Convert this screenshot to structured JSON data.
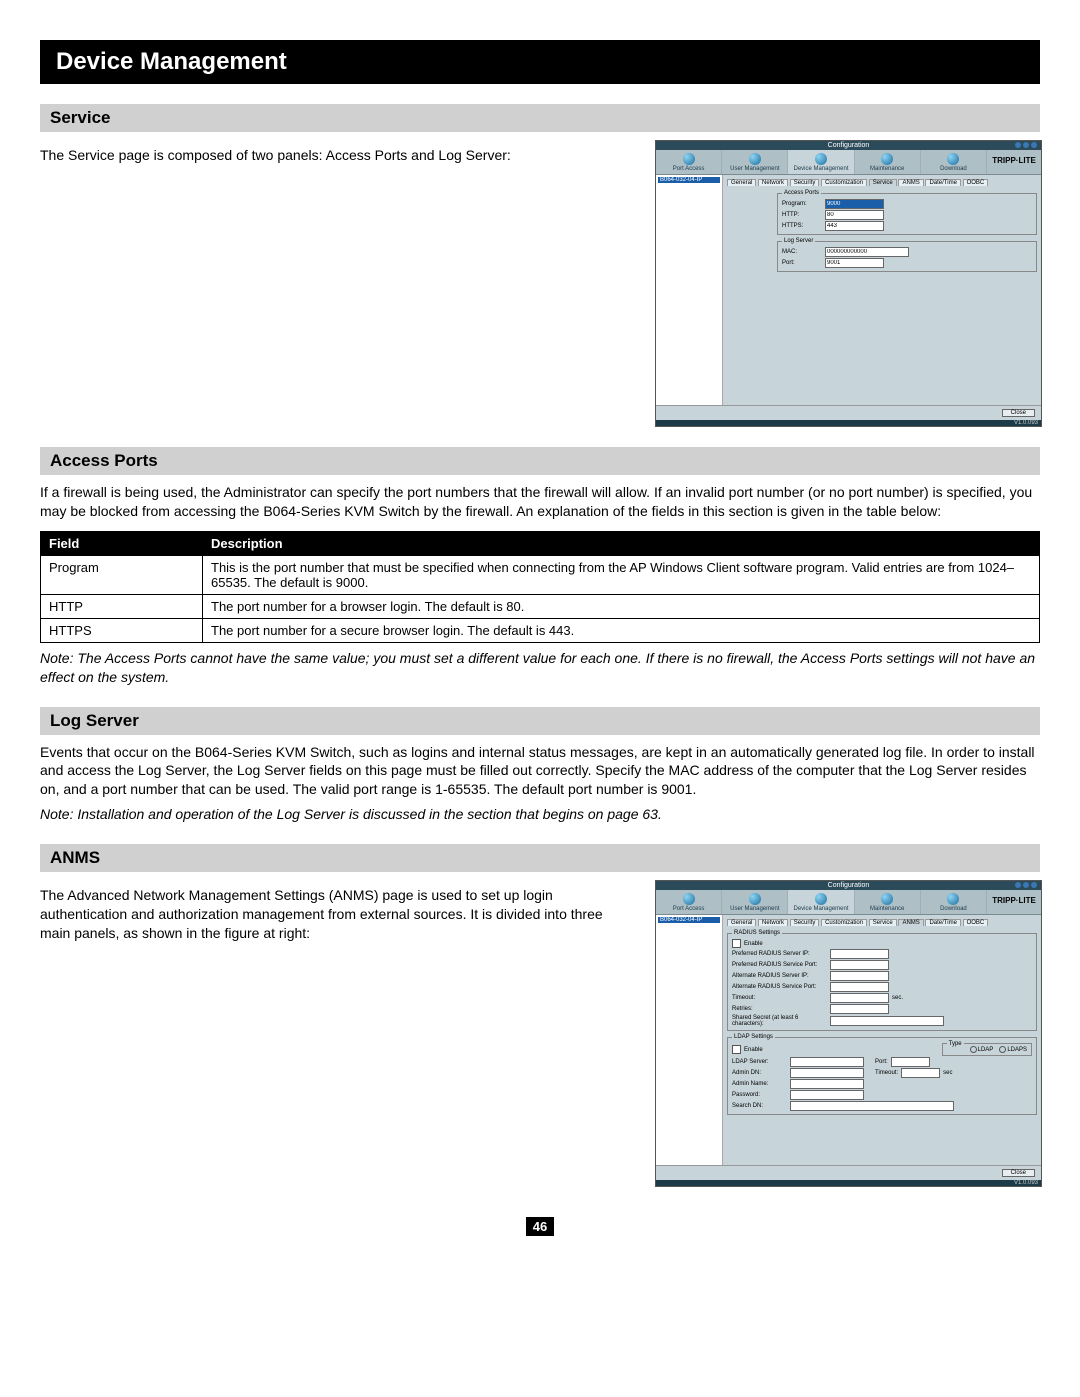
{
  "title": "Device Management",
  "sections": {
    "service": {
      "heading": "Service",
      "text": "The Service page is composed of two panels: Access Ports and Log Server:"
    },
    "access_ports": {
      "heading": "Access Ports",
      "text": "If a firewall is being used, the Administrator can specify the port numbers that the firewall will allow. If an invalid port number (or no port number) is specified, you may be blocked from accessing the B064-Series KVM Switch by the firewall. An explanation of the fields in this section is given in the table below:",
      "note": "Note: The Access Ports cannot have the same value; you must set a different value for each one. If there is no firewall, the Access Ports settings will not have an effect on the system.",
      "table": {
        "head_field": "Field",
        "head_desc": "Description",
        "rows": [
          {
            "field": "Program",
            "desc": "This is the port number that must be specified when connecting from the AP Windows Client software program. Valid entries are from 1024–65535. The default is 9000."
          },
          {
            "field": "HTTP",
            "desc": "The port number for a browser login. The default is 80."
          },
          {
            "field": "HTTPS",
            "desc": "The port number for a secure browser login. The default is 443."
          }
        ]
      }
    },
    "log_server": {
      "heading": "Log Server",
      "text": "Events that occur on the B064-Series KVM Switch, such as logins and internal status messages, are kept in an automatically generated log file. In order to install and access the Log Server, the Log Server fields on this page must be filled out correctly. Specify the MAC address of the computer that the Log Server resides on, and a port number that can be used. The valid port range is 1-65535. The default port number is 9001.",
      "note": "Note: Installation and operation of the Log Server is discussed in the section that begins on page 63."
    },
    "anms": {
      "heading": "ANMS",
      "text": "The Advanced Network Management Settings (ANMS) page is used to set up login authentication and authorization management from external sources. It is divided into three main panels, as shown in the figure at right:"
    }
  },
  "app": {
    "topbar": "Configuration",
    "brand": "TRIPP·LITE",
    "nav": [
      "Port Access",
      "User Management",
      "Device Management",
      "Maintenance",
      "Download"
    ],
    "tree_node": "B064-032-04-IP",
    "tabs": [
      "General",
      "Network",
      "Security",
      "Customization",
      "Service",
      "ANMS",
      "Date/Time",
      "OOBC"
    ],
    "service": {
      "access_ports": {
        "legend": "Access Ports",
        "program_lbl": "Program:",
        "program_val": "9000",
        "http_lbl": "HTTP:",
        "http_val": "80",
        "https_lbl": "HTTPS:",
        "https_val": "443"
      },
      "log_server": {
        "legend": "Log Server",
        "mac_lbl": "MAC:",
        "mac_val": "000000000000",
        "port_lbl": "Port:",
        "port_val": "9001"
      }
    },
    "anms": {
      "radius": {
        "legend": "RADIUS Settings",
        "enable": "Enable",
        "pref_ip": "Preferred RADIUS Server IP:",
        "pref_port": "Preferred RADIUS Service Port:",
        "alt_ip": "Alternate RADIUS Server IP:",
        "alt_port": "Alternate RADIUS Service Port:",
        "timeout": "Timeout:",
        "timeout_unit": "sec.",
        "retries": "Retries:",
        "secret": "Shared Secret (at least 6 characters):"
      },
      "ldap": {
        "legend": "LDAP Settings",
        "enable": "Enable",
        "type_legend": "Type",
        "type_ldap": "LDAP",
        "type_ldaps": "LDAPS",
        "server": "LDAP Server:",
        "port": "Port:",
        "admin_dn": "Admin DN:",
        "timeout": "Timeout:",
        "timeout_unit": "sec",
        "admin_name": "Admin Name:",
        "password": "Password:",
        "search_dn": "Search DN:"
      }
    },
    "close": "Close",
    "version": "V1.0.093"
  },
  "page_number": "46"
}
